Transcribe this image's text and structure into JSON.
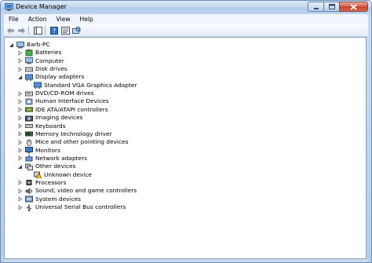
{
  "window": {
    "title": "Device Manager"
  },
  "menu": [
    "File",
    "Action",
    "View",
    "Help"
  ],
  "tree": [
    {
      "label": "Barb-PC",
      "level": 0,
      "expander": "open",
      "icon": "computer-icon"
    },
    {
      "label": "Batteries",
      "level": 1,
      "expander": "closed",
      "icon": "battery-icon"
    },
    {
      "label": "Computer",
      "level": 1,
      "expander": "closed",
      "icon": "computer-icon"
    },
    {
      "label": "Disk drives",
      "level": 1,
      "expander": "closed",
      "icon": "disk-drive-icon"
    },
    {
      "label": "Display adapters",
      "level": 1,
      "expander": "open",
      "icon": "display-adapter-icon"
    },
    {
      "label": "Standard VGA Graphics Adapter",
      "level": 2,
      "expander": "none",
      "icon": "display-adapter-icon"
    },
    {
      "label": "DVD/CD-ROM drives",
      "level": 1,
      "expander": "closed",
      "icon": "dvd-drive-icon"
    },
    {
      "label": "Human Interface Devices",
      "level": 1,
      "expander": "closed",
      "icon": "hid-icon"
    },
    {
      "label": "IDE ATA/ATAPI controllers",
      "level": 1,
      "expander": "closed",
      "icon": "ide-controller-icon"
    },
    {
      "label": "Imaging devices",
      "level": 1,
      "expander": "closed",
      "icon": "imaging-device-icon"
    },
    {
      "label": "Keyboards",
      "level": 1,
      "expander": "closed",
      "icon": "keyboard-icon"
    },
    {
      "label": "Memory technology driver",
      "level": 1,
      "expander": "closed",
      "icon": "memory-icon"
    },
    {
      "label": "Mice and other pointing devices",
      "level": 1,
      "expander": "closed",
      "icon": "mouse-icon"
    },
    {
      "label": "Monitors",
      "level": 1,
      "expander": "closed",
      "icon": "monitor-icon"
    },
    {
      "label": "Network adapters",
      "level": 1,
      "expander": "closed",
      "icon": "network-adapter-icon"
    },
    {
      "label": "Other devices",
      "level": 1,
      "expander": "open",
      "icon": "other-devices-icon"
    },
    {
      "label": "Unknown device",
      "level": 2,
      "expander": "none",
      "icon": "unknown-device-warning-icon"
    },
    {
      "label": "Processors",
      "level": 1,
      "expander": "closed",
      "icon": "processor-icon"
    },
    {
      "label": "Sound, video and game controllers",
      "level": 1,
      "expander": "closed",
      "icon": "sound-icon"
    },
    {
      "label": "System devices",
      "level": 1,
      "expander": "closed",
      "icon": "system-device-icon"
    },
    {
      "label": "Universal Serial Bus controllers",
      "level": 1,
      "expander": "closed",
      "icon": "usb-icon"
    }
  ]
}
